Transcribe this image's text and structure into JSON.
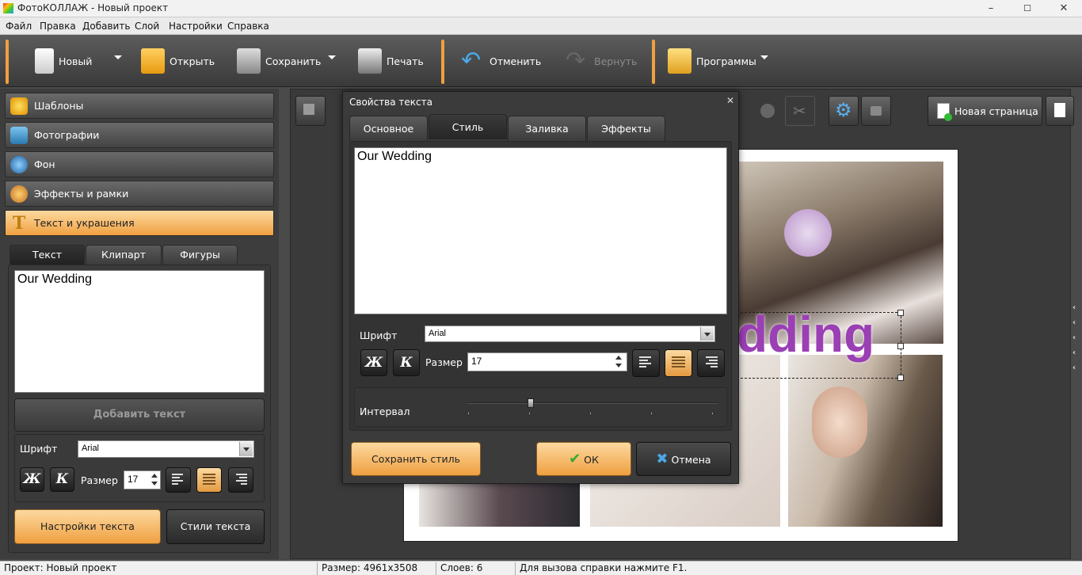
{
  "window": {
    "title": "ФотоКОЛЛАЖ - Новый проект",
    "min": "–",
    "max": "☐",
    "close": "✕"
  },
  "menu": [
    "Файл",
    "Правка",
    "Добавить",
    "Слой",
    "Настройки",
    "Справка"
  ],
  "toolbar": {
    "new": "Новый",
    "open": "Открыть",
    "save": "Сохранить",
    "print": "Печать",
    "undo": "Отменить",
    "redo": "Вернуть",
    "programs": "Программы"
  },
  "sidebar": {
    "sections": [
      "Шаблоны",
      "Фотографии",
      "Фон",
      "Эффекты и рамки",
      "Текст и украшения"
    ],
    "tabs": [
      "Текст",
      "Клипарт",
      "Фигуры"
    ],
    "text_value": "Our Wedding",
    "add_text": "Добавить текст",
    "font_label": "Шрифт",
    "font_value": "Arial",
    "bold": "Ж",
    "italic": "К",
    "size_label": "Размер",
    "size_value": "17",
    "text_settings": "Настройки текста",
    "text_styles": "Стили текста"
  },
  "canvas": {
    "new_page": "Новая страница",
    "overlay_text": "dding"
  },
  "dialog": {
    "title": "Свойства текста",
    "close": "✕",
    "tabs": [
      "Основное",
      "Стиль",
      "Заливка",
      "Эффекты"
    ],
    "text_value": "Our Wedding",
    "font_label": "Шрифт",
    "font_value": "Arial",
    "bold": "Ж",
    "italic": "К",
    "size_label": "Размер",
    "size_value": "17",
    "interval_label": "Интервал",
    "save_style": "Сохранить стиль",
    "ok": "ОК",
    "cancel": "Отмена"
  },
  "status": {
    "project_label": "Проект:",
    "project_value": "Новый проект",
    "size_label": "Размер:",
    "size_value": "4961x3508",
    "layers_label": "Слоев:",
    "layers_value": "6",
    "help": "Для вызова справки нажмите F1."
  },
  "colors": {
    "accent": "#f0a040",
    "panel": "#3d3d3d",
    "overlay_text": "#9b3fb5"
  }
}
